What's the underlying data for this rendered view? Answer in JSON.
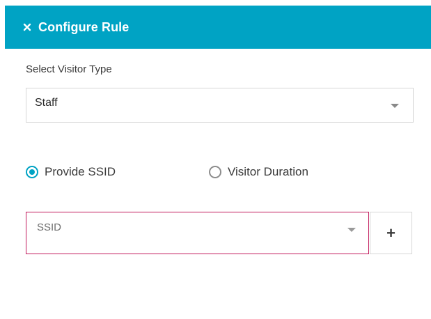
{
  "header": {
    "title": "Configure Rule",
    "close_icon": "close-icon",
    "background_color": "#00a3c4"
  },
  "visitor_type": {
    "label": "Select Visitor Type",
    "selected": "Staff"
  },
  "radio_options": [
    {
      "label": "Provide SSID",
      "checked": true
    },
    {
      "label": "Visitor Duration",
      "checked": false
    }
  ],
  "ssid": {
    "placeholder": "SSID",
    "error_border_color": "#c2185b"
  },
  "add_button": {
    "icon": "plus-icon",
    "glyph": "+"
  }
}
